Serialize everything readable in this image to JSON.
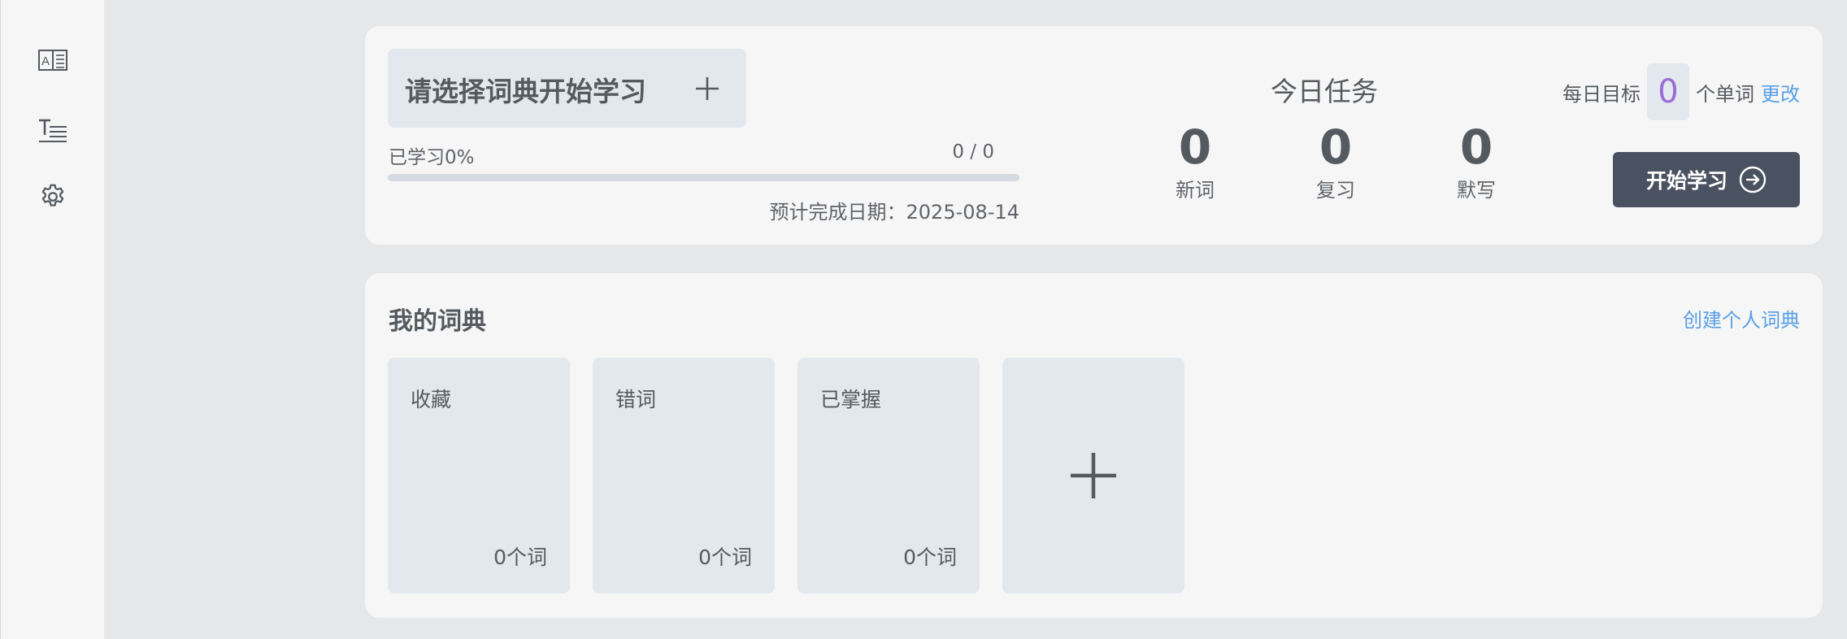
{
  "sidebar": {
    "items": [
      {
        "icon": "book-icon"
      },
      {
        "icon": "text-list-icon"
      },
      {
        "icon": "gear-icon"
      }
    ]
  },
  "study": {
    "select_label": "请选择词典开始学习",
    "progress_label": "已学习0%",
    "progress_count": "0 / 0",
    "progress_fraction": 0,
    "eta": "预计完成日期：2025-08-14"
  },
  "tasks": {
    "title": "今日任务",
    "items": [
      {
        "value": "0",
        "label": "新词"
      },
      {
        "value": "0",
        "label": "复习"
      },
      {
        "value": "0",
        "label": "默写"
      }
    ]
  },
  "goal": {
    "prefix": "每日目标",
    "value": "0",
    "suffix": "个单词",
    "change_label": "更改"
  },
  "start_button": {
    "label": "开始学习"
  },
  "dictionaries": {
    "title": "我的词典",
    "create_label": "创建个人词典",
    "items": [
      {
        "name": "收藏",
        "count": "0个词"
      },
      {
        "name": "错词",
        "count": "0个词"
      },
      {
        "name": "已掌握",
        "count": "0个词"
      }
    ]
  },
  "colors": {
    "accent": "#4a5261",
    "link": "#5aa0e6",
    "goal_value": "#9b6bd6",
    "tile_bg": "#e3e7ee",
    "page_bg": "#e6e7e9"
  }
}
